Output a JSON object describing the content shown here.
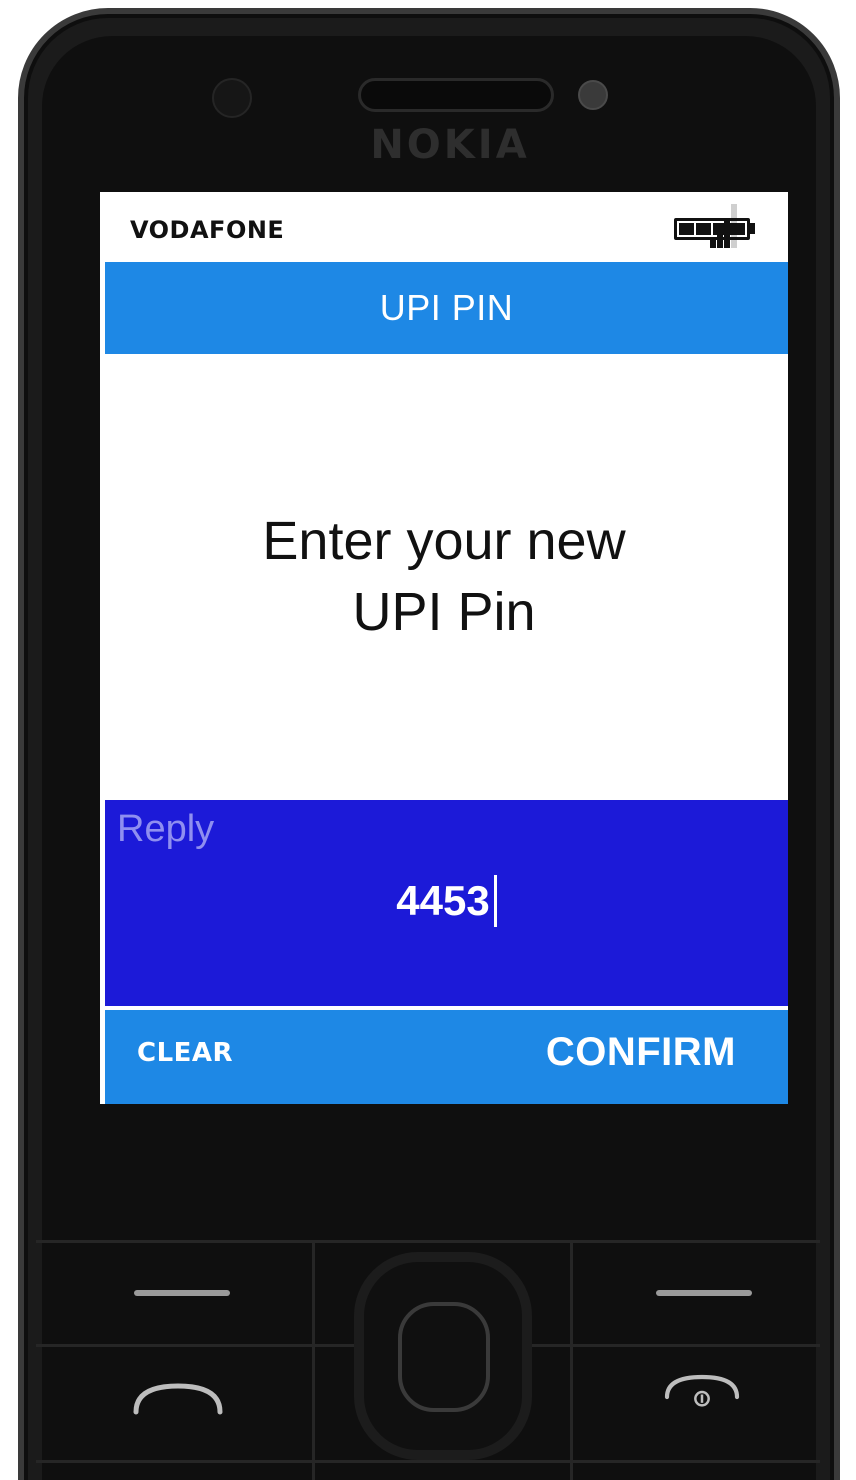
{
  "device": {
    "brand": "NOKIA"
  },
  "status_bar": {
    "carrier": "VODAFONE",
    "signal_bars": 3,
    "battery_cells": 4
  },
  "screen": {
    "title": "UPI PIN",
    "message_line1": "Enter your new",
    "message_line2": "UPI Pin",
    "reply_label": "Reply",
    "reply_value": "4453"
  },
  "softkeys": {
    "left_label": "CLEAR",
    "right_label": "CONFIRM"
  },
  "colors": {
    "title_bar": "#1e88e5",
    "reply_panel": "#1c1ad8",
    "softkey_bar": "#1e88e5"
  },
  "icons": {
    "signal": "signal-icon",
    "battery": "battery-icon",
    "call": "call-key-icon",
    "end": "end-call-key-icon"
  }
}
